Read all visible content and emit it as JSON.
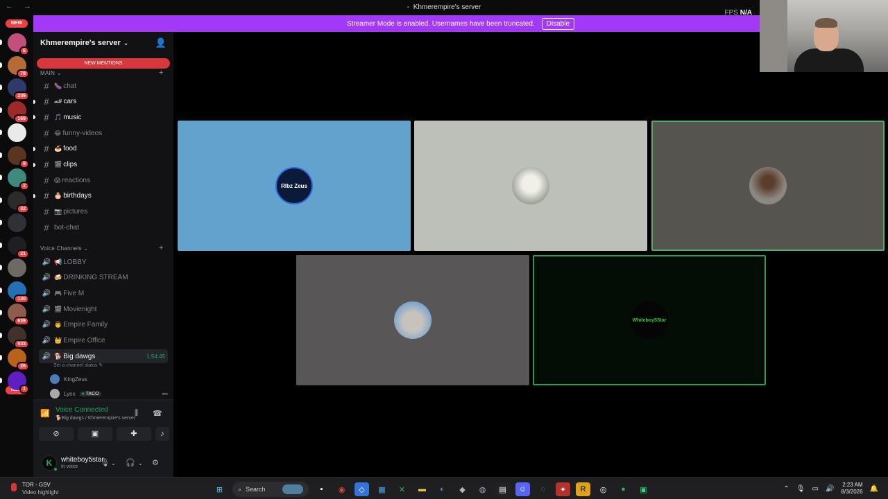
{
  "window": {
    "title": "Khmerempire's server",
    "nav_arrows": "← →",
    "fps_label": "FPS",
    "fps_value": "N/A"
  },
  "banner": {
    "text": "Streamer Mode is enabled. Usernames have been truncated.",
    "button": "Disable"
  },
  "rail": {
    "new_top": "NEW",
    "new_bottom": "NEW",
    "servers": [
      {
        "color": "#c34f7e",
        "badge": "6"
      },
      {
        "color": "#b46b35",
        "badge": "78"
      },
      {
        "color": "#2e3b6a",
        "badge": "239"
      },
      {
        "color": "#9c2a2a",
        "badge": "169"
      },
      {
        "color": "#e9ece6",
        "badge": ""
      },
      {
        "color": "#5c3522",
        "badge": "9"
      },
      {
        "color": "#3f8a7c",
        "badge": "2"
      },
      {
        "color": "#2b2b2b",
        "badge": "32"
      },
      {
        "color": "#2f3136",
        "badge": ""
      },
      {
        "color": "#1e1f22",
        "badge": "21"
      },
      {
        "color": "#6d6a66",
        "badge": ""
      },
      {
        "color": "#2370b6",
        "badge": "130"
      },
      {
        "color": "#8e5c4a",
        "badge": "639"
      },
      {
        "color": "#40322a",
        "badge": "533"
      },
      {
        "color": "#b8621a",
        "badge": "26"
      },
      {
        "color": "#5e1fc2",
        "badge": "1"
      }
    ]
  },
  "sidebar": {
    "server_name": "Khmerempire's server",
    "new_mentions": "NEW MENTIONS",
    "category_main": "MAIN",
    "category_voice": "Voice Channels",
    "text_channels": [
      {
        "name": "chat",
        "emoji": "🍆",
        "unread": false
      },
      {
        "name": "cars",
        "emoji": "🏎",
        "unread": true
      },
      {
        "name": "music",
        "emoji": "🎵",
        "unread": true
      },
      {
        "name": "funny-videos",
        "emoji": "😂",
        "unread": false
      },
      {
        "name": "food",
        "emoji": "🍝",
        "unread": true
      },
      {
        "name": "clips",
        "emoji": "🎬",
        "unread": true
      },
      {
        "name": "reactions",
        "emoji": "😱",
        "unread": false
      },
      {
        "name": "birthdays",
        "emoji": "🎂",
        "unread": true
      },
      {
        "name": "pictures",
        "emoji": "📷",
        "unread": false
      },
      {
        "name": "bot-chat",
        "emoji": "",
        "unread": false
      }
    ],
    "voice_channels": [
      {
        "name": "LOBBY",
        "emoji": "📢"
      },
      {
        "name": "DRINKING STREAM",
        "emoji": "🍻"
      },
      {
        "name": "Five M",
        "emoji": "🎮"
      },
      {
        "name": "Movienight",
        "emoji": "🎬"
      },
      {
        "name": "Empire Family",
        "emoji": "👨"
      },
      {
        "name": "Empire Office",
        "emoji": "👑"
      },
      {
        "name": "Big dawgs",
        "emoji": "🐕",
        "timer": "1:54:45"
      }
    ],
    "channel_status": "Set a channel status ✎",
    "voice_users": [
      {
        "name": "KingZeus",
        "tag": "",
        "color": "#4a7fb5"
      },
      {
        "name": "Lynx",
        "tag": "TACO",
        "color": "#aaa"
      }
    ]
  },
  "voice_panel": {
    "title": "Voice Connected",
    "subtitle": "🐕Big dawgs / Khmerempire's server",
    "buttons": [
      "camera-off",
      "screen-share",
      "activities",
      "soundboard"
    ]
  },
  "user": {
    "name": "whiteboy5star",
    "status": "In voice",
    "avatar_letter": "K"
  },
  "tiles": [
    {
      "label": "Rlbz Zeus"
    },
    {
      "label": "cat"
    },
    {
      "label": "person"
    },
    {
      "label": "cat sunglasses"
    },
    {
      "label": "Whiteboy5Star"
    }
  ],
  "taskbar": {
    "game_title": "TOR - GSV",
    "game_sub": "Video highlight",
    "search_placeholder": "Search",
    "time": "2:23 AM",
    "date": "8/3/2026"
  }
}
